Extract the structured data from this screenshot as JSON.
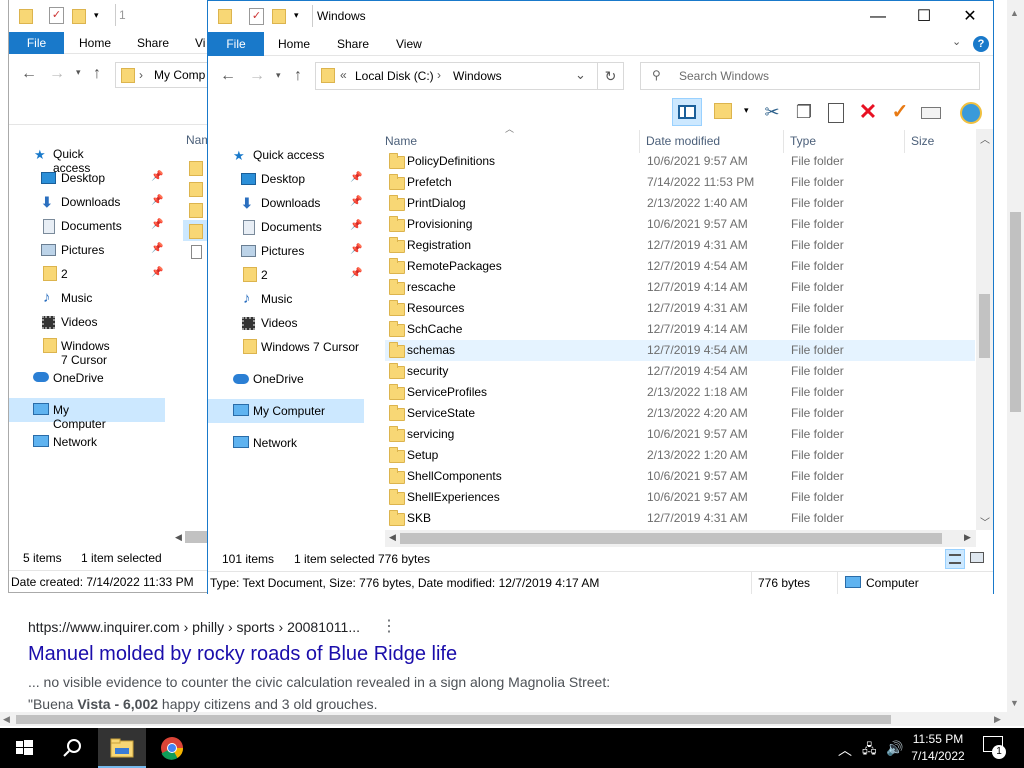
{
  "browser": {
    "result_url": "https://www.inquirer.com › philly › sports › 20081011...",
    "result_title": "Manuel molded by rocky roads of Blue Ridge life",
    "snippet_line1": "... no visible evidence to counter the civic calculation revealed in a sign along Magnolia Street:",
    "snippet_line2_pre": "\"Buena ",
    "snippet_line2_bold": "Vista - 6,002",
    "snippet_line2_post": " happy citizens and 3 old grouches."
  },
  "back_window": {
    "title_partial": "1",
    "tabs": [
      "File",
      "Home",
      "Share",
      "Vi"
    ],
    "address_partial": "My Comp",
    "column_partial": "Nam",
    "status_items": "5 items",
    "status_selected": "1 item selected",
    "details": "Date created: 7/14/2022 11:33 PM"
  },
  "window": {
    "title": "Windows",
    "tabs": {
      "file": "File",
      "home": "Home",
      "share": "Share",
      "view": "View"
    },
    "address": {
      "chevron": "«",
      "part1": "Local Disk (C:)",
      "sep": "›",
      "part2": "Windows"
    },
    "search_placeholder": "Search Windows",
    "columns": {
      "name": "Name",
      "date": "Date modified",
      "type": "Type",
      "size": "Size"
    },
    "status": {
      "count": "101 items",
      "selected": "1 item selected",
      "size": "776 bytes"
    },
    "details": {
      "text": "Type: Text Document, Size: 776 bytes, Date modified: 12/7/2019 4:17 AM",
      "size": "776 bytes",
      "location": "Computer"
    }
  },
  "nav_items": [
    {
      "label": "Quick access",
      "icon": "star-icon",
      "pinned": false
    },
    {
      "label": "Desktop",
      "icon": "desktop-icon",
      "pinned": true
    },
    {
      "label": "Downloads",
      "icon": "download-icon",
      "pinned": true
    },
    {
      "label": "Documents",
      "icon": "documents-icon",
      "pinned": true
    },
    {
      "label": "Pictures",
      "icon": "pictures-icon",
      "pinned": true
    },
    {
      "label": "2",
      "icon": "folder-icon",
      "pinned": true
    },
    {
      "label": "Music",
      "icon": "music-icon",
      "pinned": false
    },
    {
      "label": "Videos",
      "icon": "videos-icon",
      "pinned": false
    },
    {
      "label": "Windows 7 Cursor",
      "icon": "folder-icon",
      "pinned": false
    },
    {
      "label": "OneDrive",
      "icon": "cloud-icon",
      "pinned": false
    },
    {
      "label": "My Computer",
      "icon": "computer-icon",
      "pinned": false
    },
    {
      "label": "Network",
      "icon": "network-icon",
      "pinned": false
    }
  ],
  "files": [
    {
      "name": "PolicyDefinitions",
      "date": "10/6/2021 9:57 AM",
      "type": "File folder"
    },
    {
      "name": "Prefetch",
      "date": "7/14/2022 11:53 PM",
      "type": "File folder"
    },
    {
      "name": "PrintDialog",
      "date": "2/13/2022 1:40 AM",
      "type": "File folder"
    },
    {
      "name": "Provisioning",
      "date": "10/6/2021 9:57 AM",
      "type": "File folder"
    },
    {
      "name": "Registration",
      "date": "12/7/2019 4:31 AM",
      "type": "File folder"
    },
    {
      "name": "RemotePackages",
      "date": "12/7/2019 4:54 AM",
      "type": "File folder"
    },
    {
      "name": "rescache",
      "date": "12/7/2019 4:14 AM",
      "type": "File folder"
    },
    {
      "name": "Resources",
      "date": "12/7/2019 4:31 AM",
      "type": "File folder"
    },
    {
      "name": "SchCache",
      "date": "12/7/2019 4:14 AM",
      "type": "File folder"
    },
    {
      "name": "schemas",
      "date": "12/7/2019 4:54 AM",
      "type": "File folder"
    },
    {
      "name": "security",
      "date": "12/7/2019 4:54 AM",
      "type": "File folder"
    },
    {
      "name": "ServiceProfiles",
      "date": "2/13/2022 1:18 AM",
      "type": "File folder"
    },
    {
      "name": "ServiceState",
      "date": "2/13/2022 4:20 AM",
      "type": "File folder"
    },
    {
      "name": "servicing",
      "date": "10/6/2021 9:57 AM",
      "type": "File folder"
    },
    {
      "name": "Setup",
      "date": "2/13/2022 1:20 AM",
      "type": "File folder"
    },
    {
      "name": "ShellComponents",
      "date": "10/6/2021 9:57 AM",
      "type": "File folder"
    },
    {
      "name": "ShellExperiences",
      "date": "10/6/2021 9:57 AM",
      "type": "File folder"
    },
    {
      "name": "SKB",
      "date": "12/7/2019 4:31 AM",
      "type": "File folder"
    }
  ],
  "hovered_file": "schemas",
  "taskbar": {
    "time": "11:55 PM",
    "date": "7/14/2022",
    "notifications": "1"
  },
  "colors": {
    "accent": "#1979ca",
    "hover": "#e5f3ff",
    "selected": "#cce8ff",
    "link": "#1a0dab"
  }
}
